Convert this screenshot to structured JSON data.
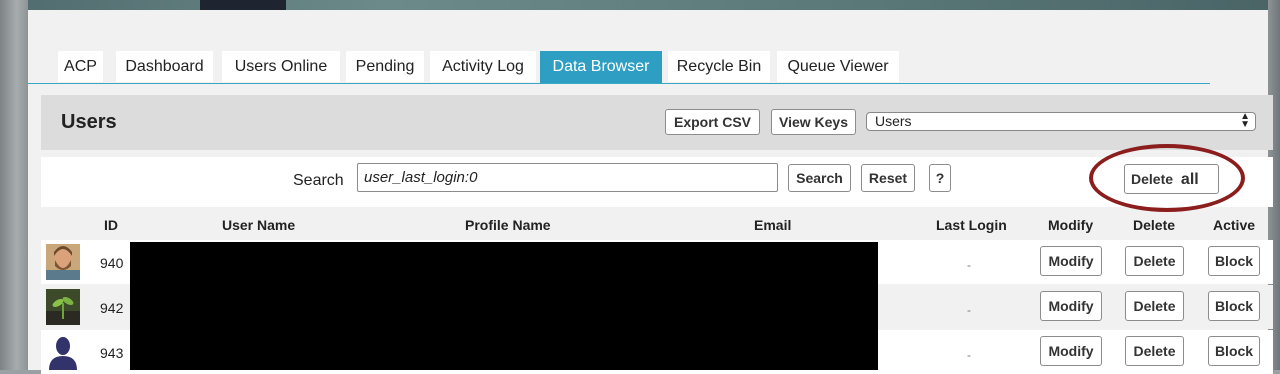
{
  "tabs": [
    {
      "label": "ACP",
      "active": false
    },
    {
      "label": "Dashboard",
      "active": false
    },
    {
      "label": "Users Online",
      "active": false
    },
    {
      "label": "Pending",
      "active": false
    },
    {
      "label": "Activity Log",
      "active": false
    },
    {
      "label": "Data Browser",
      "active": true
    },
    {
      "label": "Recycle Bin",
      "active": false
    },
    {
      "label": "Queue Viewer",
      "active": false
    }
  ],
  "header": {
    "title": "Users",
    "export_label": "Export CSV",
    "view_keys_label": "View Keys",
    "table_select": "Users"
  },
  "search": {
    "label": "Search",
    "value": "user_last_login:0",
    "search_button": "Search",
    "reset_button": "Reset",
    "help_button": "?",
    "delete_all_label": "Delete",
    "delete_all_suffix": "all"
  },
  "table": {
    "headers": {
      "id": "ID",
      "user_name": "User Name",
      "profile_name": "Profile Name",
      "email": "Email",
      "last_login": "Last Login",
      "modify": "Modify",
      "delete": "Delete",
      "active": "Active"
    },
    "rows": [
      {
        "id": "940",
        "last_login": "-",
        "modify": "Modify",
        "delete": "Delete",
        "active": "Block",
        "avatar": "bearded-man-avatar"
      },
      {
        "id": "942",
        "last_login": "-",
        "modify": "Modify",
        "delete": "Delete",
        "active": "Block",
        "avatar": "plant-avatar"
      },
      {
        "id": "943",
        "last_login": "-",
        "modify": "Modify",
        "delete": "Delete",
        "active": "Block",
        "avatar": "default-silhouette-avatar"
      }
    ]
  },
  "colors": {
    "accent": "#2f9ec3",
    "highlight_circle": "#8b1d1d"
  }
}
